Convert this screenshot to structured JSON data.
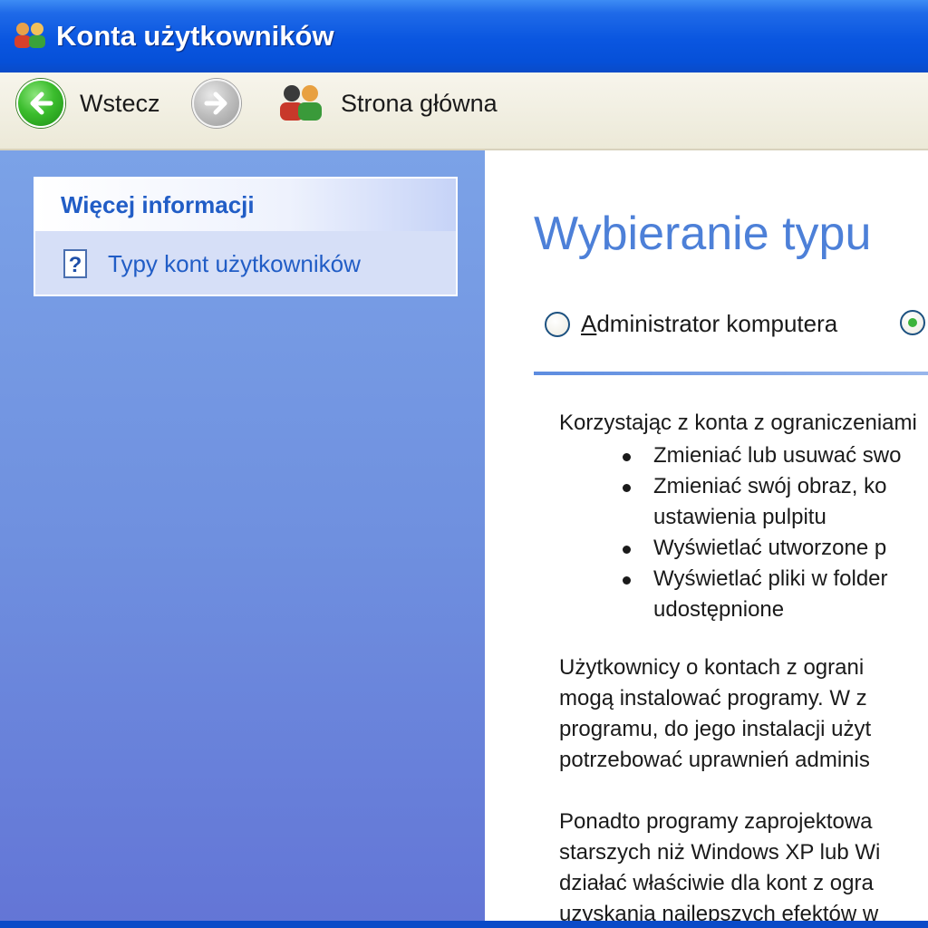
{
  "window": {
    "title": "Konta użytkowników",
    "icon": "user-accounts-icon"
  },
  "toolbar": {
    "back_label": "Wstecz",
    "back_icon": "back-arrow-icon",
    "forward_icon": "forward-arrow-icon",
    "home_label": "Strona główna",
    "home_icon": "users-icon"
  },
  "sidebar": {
    "section_title": "Więcej informacji",
    "links": [
      {
        "label": "Typy kont użytkowników",
        "icon": "help-icon"
      }
    ]
  },
  "main": {
    "heading": "Wybieranie typu",
    "account_types": [
      {
        "label": "Administrator komputera",
        "selected": false
      },
      {
        "label": "",
        "selected": true
      }
    ],
    "intro": "Korzystając z konta z ograniczeniami",
    "bullets": [
      [
        "Zmieniać lub usuwać swo"
      ],
      [
        "Zmieniać swój obraz, ko",
        "ustawienia pulpitu"
      ],
      [
        "Wyświetlać utworzone p"
      ],
      [
        "Wyświetlać pliki w folder",
        "udostępnione"
      ]
    ],
    "paragraph1": [
      "Użytkownicy o kontach z ograni",
      "mogą instalować programy. W z",
      "programu, do jego instalacji użyt",
      "potrzebować uprawnień adminis"
    ],
    "paragraph2": [
      "Ponadto programy zaprojektowa",
      "starszych niż Windows XP lub Wi",
      "działać właściwie dla kont z ogra",
      "uzyskania najlepszych efektów w"
    ]
  },
  "colors": {
    "titlebar": "#0a56e0",
    "sidebar_top": "#7ba2e7",
    "sidebar_bottom": "#6375d6",
    "link": "#215dc6",
    "heading": "#4d80d8"
  }
}
